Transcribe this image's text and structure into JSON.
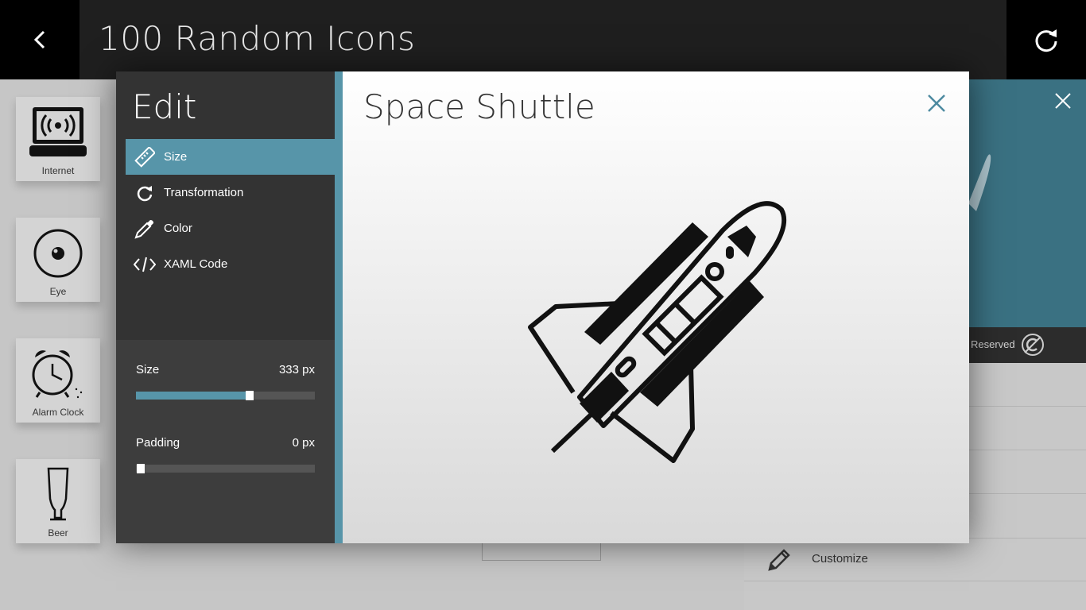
{
  "app": {
    "title": "100 Random Icons"
  },
  "topbar": {
    "back_icon": "chevron-left-icon",
    "refresh_icon": "refresh-icon"
  },
  "tiles": [
    {
      "label": "Internet",
      "icon": "wireless-monitor-icon"
    },
    {
      "label": "Eye",
      "icon": "eye-icon"
    },
    {
      "label": "Alarm Clock",
      "icon": "alarm-clock-icon"
    },
    {
      "label": "Beer",
      "icon": "beer-glass-icon"
    }
  ],
  "right_panel": {
    "reserved_text": "Reserved",
    "customize_label": "Customize"
  },
  "edit": {
    "title": "Edit",
    "nav": [
      {
        "label": "Size",
        "icon": "ruler-icon",
        "active": true
      },
      {
        "label": "Transformation",
        "icon": "rotate-icon",
        "active": false
      },
      {
        "label": "Color",
        "icon": "eyedropper-icon",
        "active": false
      },
      {
        "label": "XAML Code",
        "icon": "code-icon",
        "active": false
      }
    ],
    "size": {
      "label": "Size",
      "value": "333 px",
      "fraction": 0.64
    },
    "padding": {
      "label": "Padding",
      "value": "0 px",
      "fraction": 0.0
    }
  },
  "preview": {
    "title": "Space Shuttle",
    "icon": "space-shuttle-icon"
  },
  "colors": {
    "accent": "#5795a9",
    "edit_bg": "#333333",
    "topbar": "#1f1f1f",
    "hero": "#3a7182"
  }
}
